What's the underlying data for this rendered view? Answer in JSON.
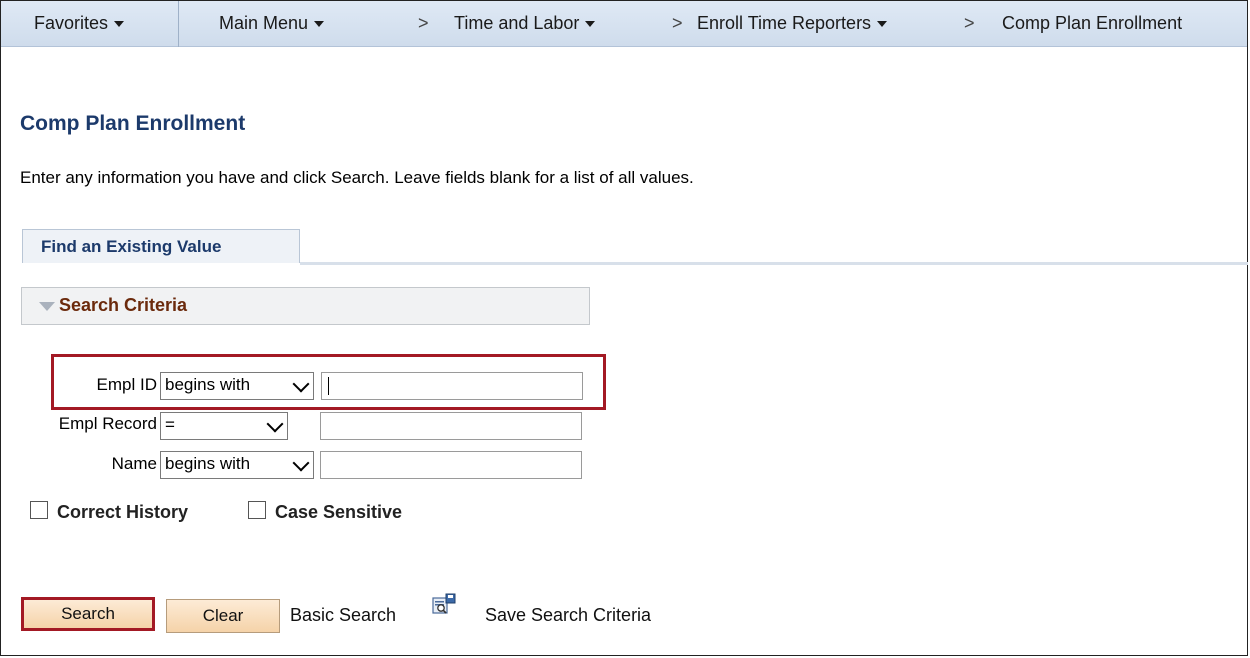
{
  "nav": {
    "favorites": "Favorites",
    "main_menu": "Main Menu",
    "sep": ">",
    "time_and_labor": "Time and Labor",
    "enroll_time_reporters": "Enroll Time Reporters",
    "comp_plan_enrollment": "Comp Plan Enrollment"
  },
  "page": {
    "title": "Comp Plan Enrollment",
    "instructions": "Enter any information you have and click Search. Leave fields blank for a list of all values."
  },
  "tabs": [
    {
      "label": "Find an Existing Value"
    }
  ],
  "criteria": {
    "header": "Search Criteria",
    "fields": [
      {
        "label": "Empl ID",
        "operator": "begins with",
        "value": ""
      },
      {
        "label": "Empl Record",
        "operator": "=",
        "value": ""
      },
      {
        "label": "Name",
        "operator": "begins with",
        "value": ""
      }
    ],
    "checkboxes": [
      {
        "label": "Correct History",
        "checked": false
      },
      {
        "label": "Case Sensitive",
        "checked": false
      }
    ]
  },
  "actions": {
    "search": "Search",
    "clear": "Clear",
    "basic_search": "Basic Search",
    "save_search_criteria": "Save Search Criteria"
  },
  "colors": {
    "highlight": "#a31924",
    "title": "#1c3a6b",
    "criteria_label": "#6b2a0c",
    "button": "#f5d3a9"
  }
}
